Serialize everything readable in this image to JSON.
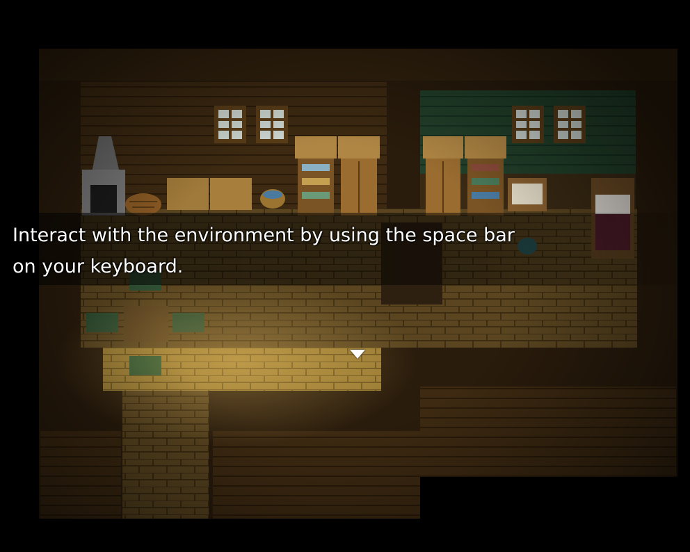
{
  "dialog": {
    "message": "Interact with the environment by using the space bar\non your keyboard."
  },
  "colors": {
    "background": "#000000",
    "wood_wall": "#3a2812",
    "wood_wall_dark": "#2a1c0c",
    "floor_brick": "#5e4a22",
    "floor_brick_lit": "#a88a3c",
    "green_wall": "#1f3a22",
    "dialog_text": "#ffffff"
  },
  "icons": {
    "continue": "triangle-down-icon"
  }
}
